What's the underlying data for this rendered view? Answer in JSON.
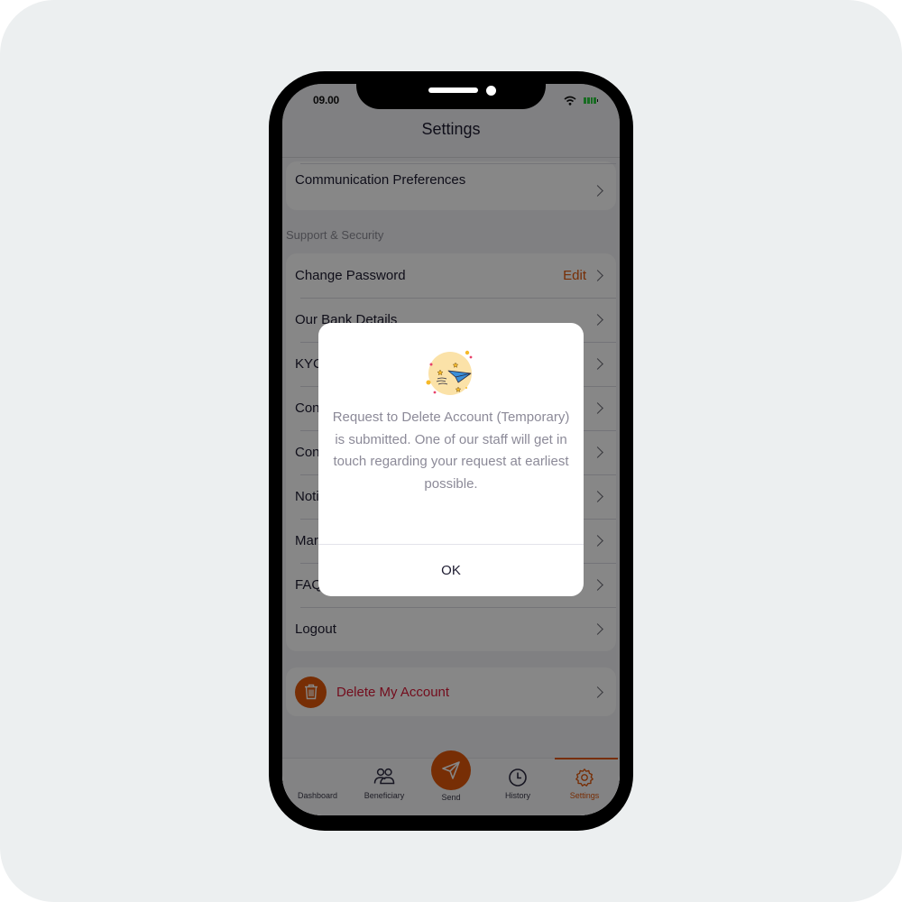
{
  "status_bar": {
    "time": "09.00",
    "wifi_icon": "wifi-icon",
    "battery_icon": "battery-icon"
  },
  "header": {
    "title": "Settings"
  },
  "preferences": {
    "items": [
      {
        "label": "Communication Preferences",
        "icon": "chevron-right-icon"
      }
    ]
  },
  "support_security": {
    "section_label": "Support & Security",
    "items": [
      {
        "label": "Change Password",
        "action": "Edit",
        "icon": "chevron-right-icon"
      },
      {
        "label": "Our Bank Details",
        "icon": "chevron-right-icon"
      },
      {
        "label": "KYC",
        "icon": "chevron-right-icon"
      },
      {
        "label": "Con",
        "icon": "chevron-right-icon"
      },
      {
        "label": "Con",
        "icon": "chevron-right-icon"
      },
      {
        "label": "Noti",
        "icon": "chevron-right-icon"
      },
      {
        "label": "Mar",
        "icon": "chevron-right-icon"
      },
      {
        "label": "FAQ",
        "icon": "chevron-right-icon"
      },
      {
        "label": "Logout",
        "icon": "chevron-right-icon"
      }
    ]
  },
  "danger_zone": {
    "delete_label": "Delete My Account",
    "icon": "trash-icon"
  },
  "tabbar": {
    "tabs": [
      {
        "label": "Dashboard",
        "icon": "dashboard-icon"
      },
      {
        "label": "Beneficiary",
        "icon": "users-icon"
      },
      {
        "label": "Send",
        "icon": "paper-plane-icon"
      },
      {
        "label": "History",
        "icon": "clock-icon"
      },
      {
        "label": "Settings",
        "icon": "gear-icon",
        "active": true
      }
    ]
  },
  "modal": {
    "illustration": "paper-plane-illustration",
    "message": "Request to Delete Account (Temporary) is submitted. One of our staff will get in touch regarding your request at earliest possible.",
    "ok_label": "OK"
  },
  "colors": {
    "accent": "#e0570b",
    "danger_text": "#d91a38",
    "overlay": "rgba(0,0,0,0.47)",
    "background": "#eceff0"
  }
}
